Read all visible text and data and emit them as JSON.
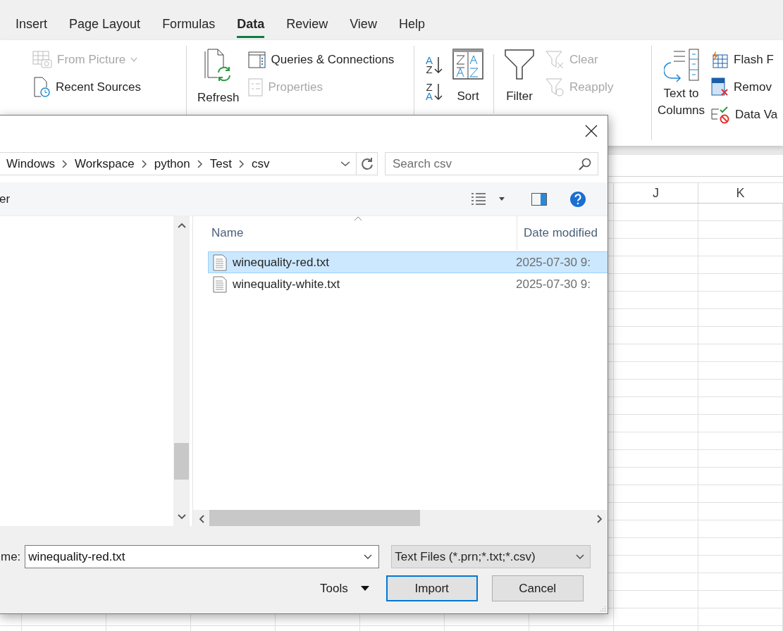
{
  "ribbon_tabs": [
    {
      "label": "Insert",
      "selected": false
    },
    {
      "label": "Page Layout",
      "selected": false
    },
    {
      "label": "Formulas",
      "selected": false
    },
    {
      "label": "Data",
      "selected": true
    },
    {
      "label": "Review",
      "selected": false
    },
    {
      "label": "View",
      "selected": false
    },
    {
      "label": "Help",
      "selected": false
    }
  ],
  "get_data": {
    "commands": [
      {
        "label": "From Picture",
        "disabled": true,
        "dropdown": true
      },
      {
        "label": "Recent Sources",
        "disabled": false,
        "dropdown": false
      }
    ]
  },
  "queries": {
    "refresh": {
      "label": "Refresh"
    },
    "commands": [
      {
        "label": "Queries & Connections",
        "disabled": false
      },
      {
        "label": "Properties",
        "disabled": true
      }
    ]
  },
  "sort_filter": {
    "sort_az": [
      "A",
      "Z"
    ],
    "sort_za": [
      "Z",
      "A"
    ],
    "sort": {
      "label": "Sort"
    },
    "filter": {
      "label": "Filter"
    },
    "commands": [
      {
        "label": "Clear",
        "disabled": true
      },
      {
        "label": "Reapply",
        "disabled": true
      }
    ]
  },
  "data_tools": {
    "text_to_columns": {
      "label": "Text to",
      "label_2": "Columns"
    },
    "commands": [
      {
        "label": "Flash F"
      },
      {
        "label": "Remov"
      },
      {
        "label": "Data Va"
      }
    ]
  },
  "sheet": {
    "columns": [
      "J",
      "K"
    ]
  },
  "dialog": {
    "address": {
      "crumbs": [
        "Windows",
        "Workspace",
        "python",
        "Test",
        "csv"
      ]
    },
    "search": {
      "placeholder": "Search csv"
    },
    "toolbar": {
      "cut_label": "er"
    },
    "files": {
      "columns": [
        "Name",
        "Date modified"
      ],
      "rows": [
        {
          "name": "winequality-red.txt",
          "date": "2025-07-30 9:",
          "selected": true
        },
        {
          "name": "winequality-white.txt",
          "date": "2025-07-30 9:",
          "selected": false
        }
      ]
    },
    "file_name": {
      "label": "me:",
      "value": "winequality-red.txt"
    },
    "file_type": {
      "value": "Text Files (*.prn;*.txt;*.csv)"
    },
    "tools": {
      "label": "Tools"
    },
    "buttons": [
      {
        "label": "Import",
        "default": true
      },
      {
        "label": "Cancel",
        "default": false
      }
    ]
  }
}
